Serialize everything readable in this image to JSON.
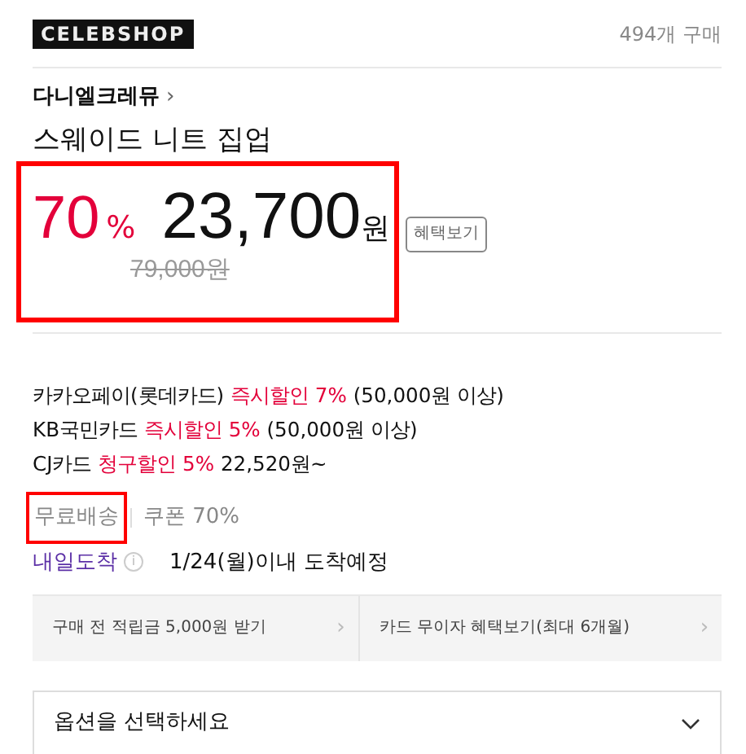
{
  "header": {
    "logo": "CELEBSHOP",
    "purchase_count": "494개 구매"
  },
  "product": {
    "brand": "다니엘크레뮤",
    "brand_arrow": "›",
    "title": "스웨이드 니트 집업"
  },
  "price": {
    "highlighted": true,
    "discount": "70",
    "discount_unit": "%",
    "sale_price": "23,700",
    "sale_unit": "원",
    "original_price": "79,000",
    "original_unit": "원",
    "benefit_button": "혜택보기"
  },
  "card_benefits": [
    [
      {
        "text": "카카오페이(롯데카드) ",
        "highlight": false
      },
      {
        "text": "즉시할인 7%",
        "highlight": true
      },
      {
        "text": " (50,000원 이상)",
        "highlight": false
      }
    ],
    [
      {
        "text": "KB국민카드 ",
        "highlight": false
      },
      {
        "text": "즉시할인 5%",
        "highlight": true
      },
      {
        "text": " (50,000원 이상)",
        "highlight": false
      }
    ],
    [
      {
        "text": "CJ카드 ",
        "highlight": false
      },
      {
        "text": "청구할인 5%",
        "highlight": true
      },
      {
        "text": " 22,520원~",
        "highlight": false
      }
    ]
  ],
  "tags": [
    {
      "label": "무료배송",
      "highlighted": true
    },
    {
      "label": "쿠폰 70%",
      "highlighted": false
    }
  ],
  "delivery": {
    "label": "내일도착",
    "info": "i",
    "text": "1/24(월)이내 도착예정"
  },
  "promo_links": [
    {
      "label": "구매 전 적립금 5,000원 받기",
      "arrow": "›"
    },
    {
      "label": "카드 무이자 혜택보기(최대 6개월)",
      "arrow": "›"
    }
  ],
  "option_select": {
    "placeholder": "옵션을 선택하세요"
  }
}
